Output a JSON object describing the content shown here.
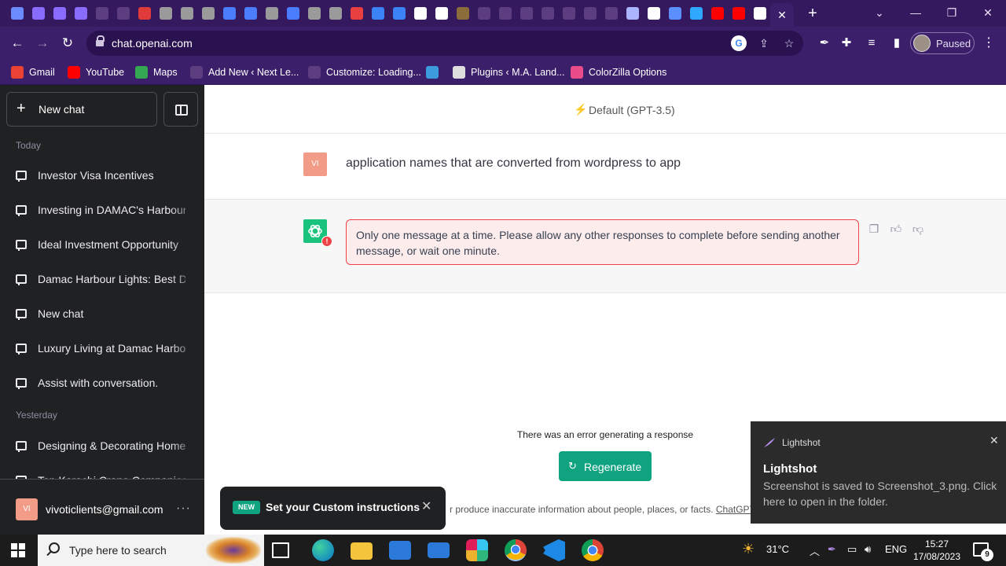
{
  "browser": {
    "url": "chat.openai.com",
    "profile_status": "Paused",
    "tab_icon_colors": [
      "#6b8cff",
      "#8a6bff",
      "#8a6bff",
      "#8a6bff",
      "#5b3d80",
      "#5b3d80",
      "#e03a3a",
      "#9a9a9a",
      "#9a9a9a",
      "#9a9a9a",
      "#4a7dff",
      "#4a7dff",
      "#9a9a9a",
      "#4a7dff",
      "#9a9a9a",
      "#9a9a9a",
      "#e84040",
      "#3b82f6",
      "#3b82f6",
      "#ffffff",
      "#ffffff",
      "#8a6d3b",
      "#5b3d80",
      "#5b3d80",
      "#5b3d80",
      "#5b3d80",
      "#5b3d80",
      "#5b3d80",
      "#5b3d80",
      "#aab4ff",
      "#ffffff",
      "#5b8fff",
      "#2fa8ff",
      "#ff0000",
      "#ff0000",
      "#ffffff"
    ],
    "bookmarks": [
      {
        "label": "Gmail",
        "color": "#ea4335"
      },
      {
        "label": "YouTube",
        "color": "#ff0000"
      },
      {
        "label": "Maps",
        "color": "#34a853"
      },
      {
        "label": "Add New ‹ Next Le...",
        "color": "#5b3d80"
      },
      {
        "label": "Customize: Loading...",
        "color": "#5b3d80"
      },
      {
        "label": "",
        "color": "#3b9bdc"
      },
      {
        "label": "Plugins ‹ M.A. Land...",
        "color": "#dddddd"
      },
      {
        "label": "ColorZilla Options",
        "color": "#e84d8a"
      }
    ]
  },
  "sidebar": {
    "new_chat_label": "New chat",
    "today_label": "Today",
    "yesterday_label": "Yesterday",
    "today_items": [
      "Investor Visa Incentives",
      "Investing in DAMAC's Harbour",
      "Ideal Investment Opportunity",
      "Damac Harbour Lights: Best D",
      "New chat",
      "Luxury Living at Damac Harbo",
      "Assist with conversation."
    ],
    "yesterday_items": [
      "Designing & Decorating Home",
      "Top Karachi Crane Companies"
    ],
    "user_initials": "VI",
    "user_email": "vivoticlients@gmail.com"
  },
  "main": {
    "model_label": "Default (GPT-3.5)",
    "user_initials": "VI",
    "user_message": "application names that are converted from wordpress to app",
    "error_badge": "!",
    "error_message": "Only one message at a time. Please allow any other responses to complete before sending another message, or wait one minute.",
    "error_line": "There was an error generating a response",
    "regenerate_label": "Regenerate",
    "disclaimer_text": "r produce inaccurate information about people, places, or facts.",
    "disclaimer_link": "ChatGPT"
  },
  "toast": {
    "badge": "NEW",
    "text": "Set your Custom instructions"
  },
  "lightshot": {
    "app": "Lightshot",
    "title": "Lightshot",
    "body": "Screenshot is saved to Screenshot_3.png. Click here to open in the folder."
  },
  "taskbar": {
    "search_placeholder": "Type here to search",
    "temperature": "31°C",
    "language": "ENG",
    "time": "15:27",
    "date": "17/08/2023",
    "notification_count": "9"
  },
  "colors": {
    "accent": "#10a37f",
    "sidebar_bg": "#202123",
    "browser_bg": "#3b1f6b",
    "error": "#ef4146"
  }
}
